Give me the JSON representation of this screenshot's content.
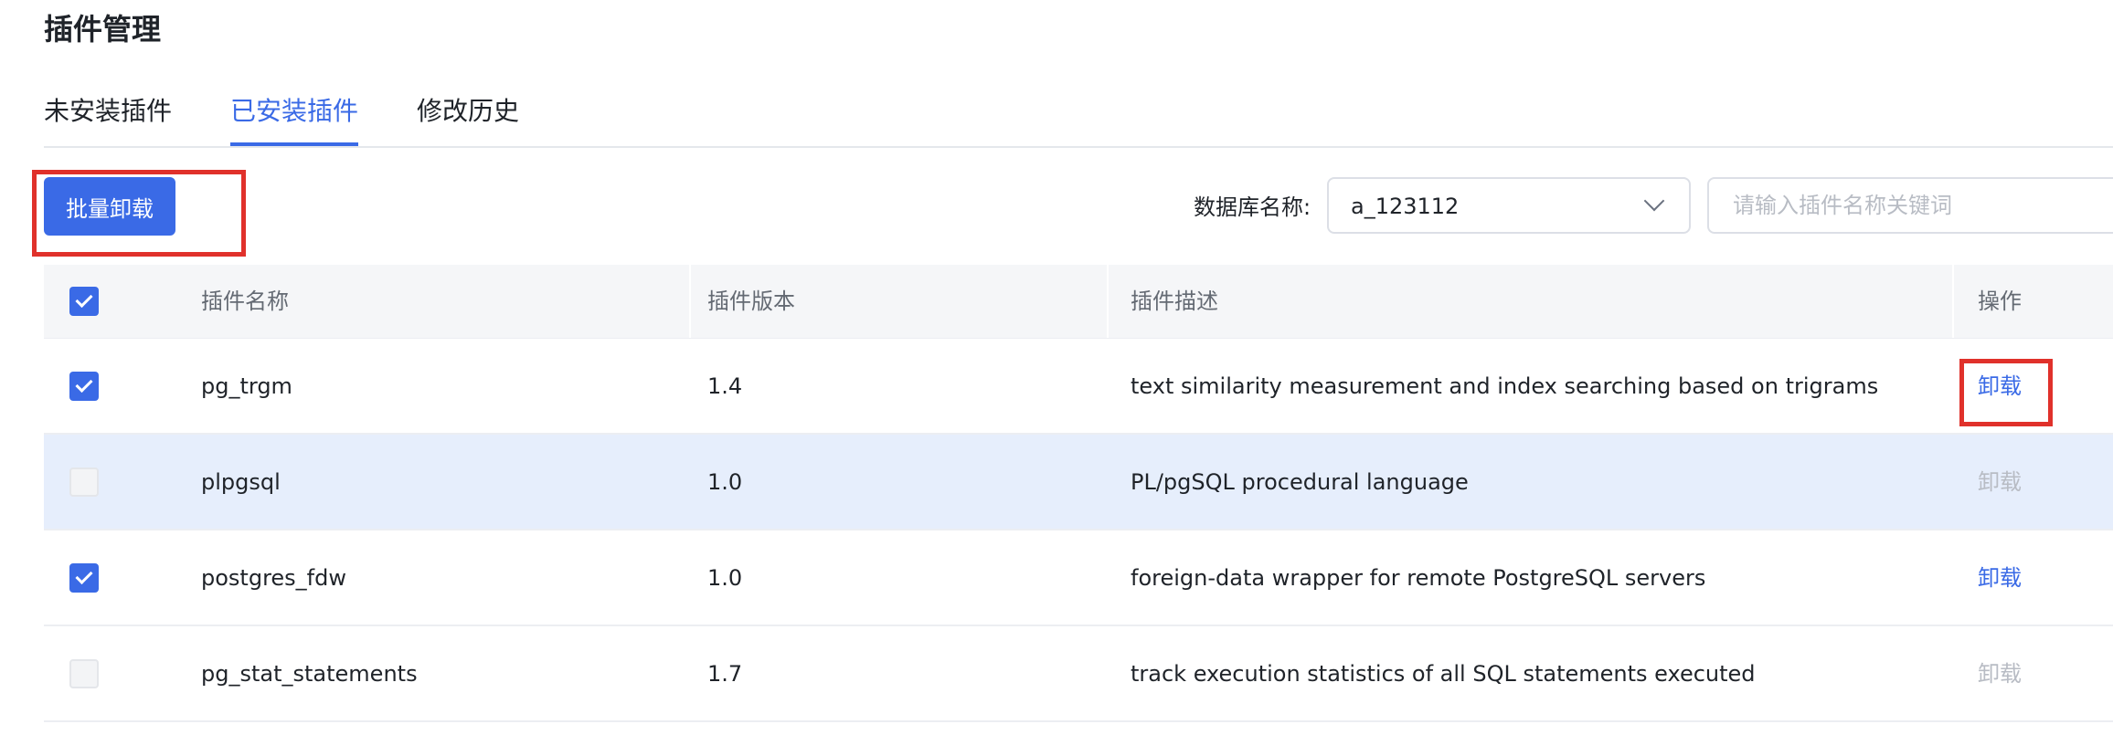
{
  "page": {
    "title": "插件管理"
  },
  "tabs": [
    {
      "label": "未安装插件",
      "active": false
    },
    {
      "label": "已安装插件",
      "active": true
    },
    {
      "label": "修改历史",
      "active": false
    }
  ],
  "toolbar": {
    "batch_uninstall_label": "批量卸载",
    "db_label": "数据库名称:",
    "db_value": "a_123112",
    "search_placeholder": "请输入插件名称关键词"
  },
  "table": {
    "columns": [
      "插件名称",
      "插件版本",
      "插件描述",
      "操作"
    ],
    "rows": [
      {
        "name": "pg_trgm",
        "version": "1.4",
        "description": "text similarity measurement and index searching based on trigrams",
        "action": "卸载",
        "checked": true,
        "enabled": true
      },
      {
        "name": "plpgsql",
        "version": "1.0",
        "description": "PL/pgSQL procedural language",
        "action": "卸载",
        "checked": false,
        "enabled": false
      },
      {
        "name": "postgres_fdw",
        "version": "1.0",
        "description": "foreign-data wrapper for remote PostgreSQL servers",
        "action": "卸载",
        "checked": true,
        "enabled": true
      },
      {
        "name": "pg_stat_statements",
        "version": "1.7",
        "description": "track execution statistics of all SQL statements executed",
        "action": "卸载",
        "checked": false,
        "enabled": false
      }
    ]
  },
  "colors": {
    "accent": "#3a6ae6",
    "highlight_box": "#e0312b",
    "row_highlight": "#e6eefc",
    "disabled_text": "#b8bcc4"
  }
}
